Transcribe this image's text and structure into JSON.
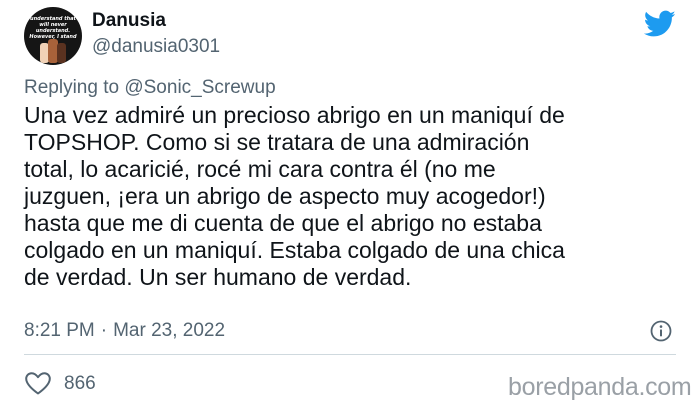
{
  "author": {
    "display_name": "Danusia",
    "handle": "@danusia0301",
    "avatar_text": "I understand that I\nwill never\nunderstand.\nHowever, I stand"
  },
  "reply": {
    "prefix": "Replying to",
    "to": "@Sonic_Screwup"
  },
  "tweet": {
    "text": "Una vez admiré un precioso abrigo en un maniquí de\nTOPSHOP. Como si se tratara de una admiración\ntotal, lo acaricié, rocé mi cara contra él (no me\njuzguen, ¡era un abrigo de aspecto muy acogedor!)\nhasta que me di cuenta de que el abrigo no estaba\ncolgado en un maniquí. Estaba colgado de una chica\nde verdad. Un ser humano de verdad.",
    "time": "8:21 PM",
    "separator": "·",
    "date": "Mar 23, 2022",
    "likes": "866"
  },
  "icons": {
    "logo": "twitter-bird-icon",
    "info": "info-icon",
    "like": "heart-icon"
  },
  "watermark": "boredpanda.com",
  "colors": {
    "brand": "#1d9bf0",
    "secondary_text": "#536471",
    "primary_text": "#0f1419"
  }
}
